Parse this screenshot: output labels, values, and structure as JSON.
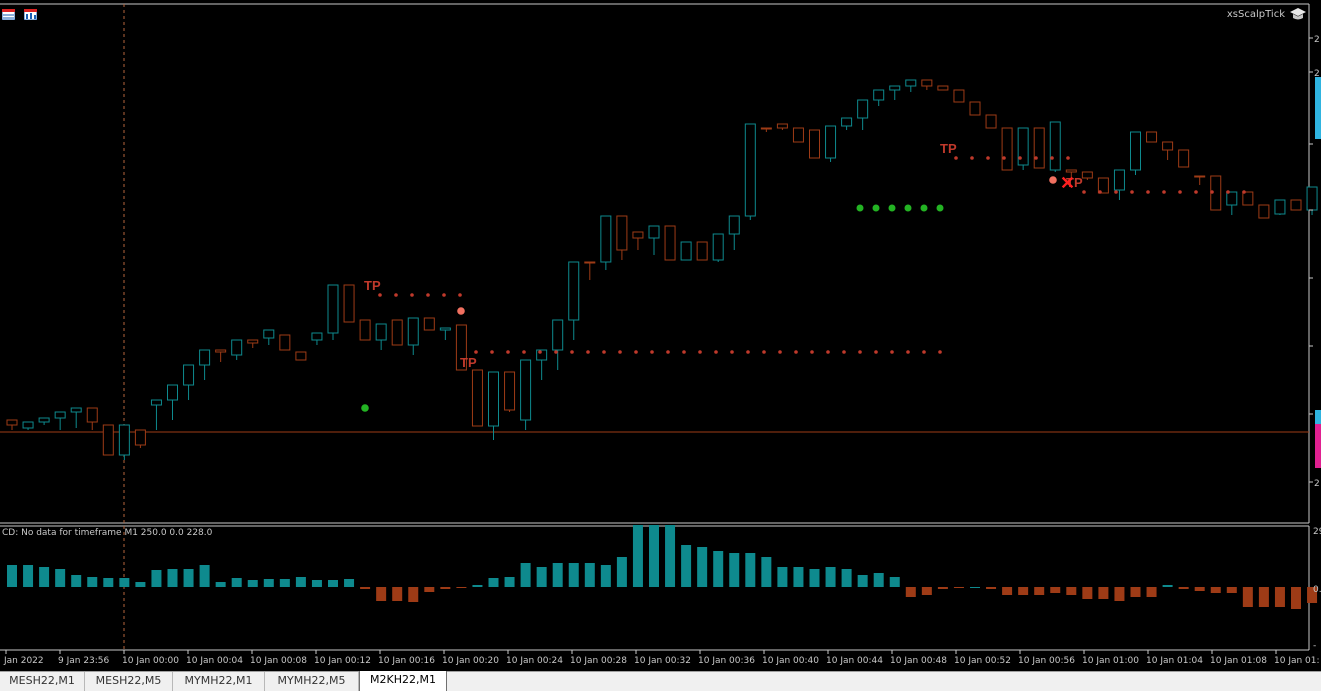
{
  "toolbar": {
    "icons": [
      "chart-grid-icon",
      "chart-props-icon"
    ]
  },
  "indicator_name": "xsScalpTick",
  "indicator_label": "CD: No data for timeframe M1 250.0 0.0 228.0",
  "price_ticks": [
    "2",
    "2",
    "2"
  ],
  "ind_ticks": [
    "29",
    "0.0",
    "-"
  ],
  "colors": {
    "bull": "#0e8a8e",
    "bear": "#9e3b16",
    "tp": "#c0392b",
    "green": "#23b323",
    "salmon": "#f07060"
  },
  "tp_label": "TP",
  "time_labels": [
    "Jan 2022",
    "9 Jan 23:56",
    "10 Jan 00:00",
    "10 Jan 00:04",
    "10 Jan 00:08",
    "10 Jan 00:12",
    "10 Jan 00:16",
    "10 Jan 00:20",
    "10 Jan 00:24",
    "10 Jan 00:28",
    "10 Jan 00:32",
    "10 Jan 00:36",
    "10 Jan 00:40",
    "10 Jan 00:44",
    "10 Jan 00:48",
    "10 Jan 00:52",
    "10 Jan 00:56",
    "10 Jan 01:00",
    "10 Jan 01:04",
    "10 Jan 01:08",
    "10 Jan 01:"
  ],
  "tabs": [
    {
      "label": "MESH22,M1",
      "active": false
    },
    {
      "label": "MESH22,M5",
      "active": false
    },
    {
      "label": "MYMH22,M1",
      "active": false
    },
    {
      "label": "MYMH22,M5",
      "active": false
    },
    {
      "label": "M2KH22,M1",
      "active": true
    }
  ],
  "chart_data": {
    "type": "candlestick",
    "candles": [
      [
        420,
        430,
        390,
        425
      ],
      [
        428,
        430,
        410,
        422
      ],
      [
        422,
        425,
        395,
        418
      ],
      [
        418,
        430,
        390,
        412
      ],
      [
        412,
        428,
        400,
        408
      ],
      [
        408,
        430,
        385,
        422
      ],
      [
        425,
        440,
        420,
        455
      ],
      [
        455,
        460,
        420,
        425
      ],
      [
        430,
        448,
        425,
        445
      ],
      [
        405,
        430,
        380,
        400
      ],
      [
        400,
        420,
        370,
        385
      ],
      [
        385,
        400,
        350,
        365
      ],
      [
        365,
        380,
        340,
        350
      ],
      [
        350,
        362,
        300,
        352
      ],
      [
        355,
        360,
        300,
        340
      ],
      [
        340,
        348,
        320,
        343
      ],
      [
        338,
        345,
        300,
        330
      ],
      [
        335,
        340,
        315,
        350
      ],
      [
        352,
        360,
        320,
        360
      ],
      [
        340,
        345,
        310,
        333
      ],
      [
        333,
        340,
        270,
        285
      ],
      [
        285,
        290,
        275,
        322
      ],
      [
        320,
        330,
        280,
        340
      ],
      [
        340,
        350,
        290,
        324
      ],
      [
        320,
        330,
        310,
        345
      ],
      [
        345,
        355,
        300,
        318
      ],
      [
        318,
        325,
        305,
        330
      ],
      [
        330,
        340,
        320,
        328
      ],
      [
        325,
        355,
        320,
        370
      ],
      [
        370,
        376,
        360,
        426
      ],
      [
        426,
        440,
        360,
        372
      ],
      [
        372,
        412,
        350,
        410
      ],
      [
        420,
        430,
        380,
        360
      ],
      [
        360,
        380,
        350,
        350
      ],
      [
        350,
        370,
        330,
        320
      ],
      [
        320,
        340,
        300,
        262
      ],
      [
        262,
        280,
        230,
        262
      ],
      [
        262,
        270,
        190,
        216
      ],
      [
        216,
        260,
        210,
        250
      ],
      [
        232,
        250,
        200,
        238
      ],
      [
        238,
        255,
        210,
        226
      ],
      [
        226,
        260,
        215,
        260
      ],
      [
        260,
        250,
        235,
        242
      ],
      [
        242,
        255,
        230,
        260
      ],
      [
        260,
        262,
        230,
        234
      ],
      [
        234,
        250,
        210,
        216
      ],
      [
        216,
        220,
        100,
        124
      ],
      [
        128,
        132,
        100,
        128
      ],
      [
        124,
        130,
        110,
        128
      ],
      [
        128,
        138,
        120,
        142
      ],
      [
        130,
        130,
        120,
        158
      ],
      [
        158,
        162,
        100,
        126
      ],
      [
        126,
        130,
        90,
        118
      ],
      [
        118,
        130,
        100,
        100
      ],
      [
        100,
        106,
        60,
        90
      ],
      [
        90,
        100,
        20,
        86
      ],
      [
        86,
        92,
        80,
        80
      ],
      [
        80,
        90,
        55,
        86
      ],
      [
        86,
        90,
        70,
        90
      ],
      [
        90,
        100,
        80,
        102
      ],
      [
        102,
        110,
        90,
        115
      ],
      [
        115,
        120,
        100,
        128
      ],
      [
        128,
        140,
        120,
        170
      ],
      [
        165,
        170,
        120,
        128
      ],
      [
        128,
        138,
        110,
        168
      ],
      [
        170,
        172,
        120,
        122
      ],
      [
        170,
        180,
        160,
        172
      ],
      [
        172,
        180,
        165,
        178
      ],
      [
        178,
        185,
        160,
        193
      ],
      [
        190,
        200,
        165,
        170
      ],
      [
        170,
        175,
        130,
        132
      ],
      [
        132,
        140,
        130,
        142
      ],
      [
        142,
        160,
        130,
        150
      ],
      [
        150,
        165,
        130,
        167
      ],
      [
        176,
        185,
        170,
        176
      ],
      [
        176,
        200,
        176,
        210
      ],
      [
        205,
        215,
        200,
        192
      ],
      [
        192,
        200,
        180,
        205
      ],
      [
        205,
        210,
        185,
        218
      ],
      [
        214,
        215,
        195,
        200
      ],
      [
        200,
        210,
        190,
        210
      ],
      [
        210,
        215,
        180,
        187
      ],
      [
        187,
        200,
        180,
        204
      ],
      [
        204,
        215,
        195,
        220
      ],
      [
        200,
        210,
        190,
        205
      ],
      [
        205,
        215,
        180,
        225
      ],
      [
        225,
        230,
        180,
        245
      ],
      [
        245,
        250,
        245,
        288
      ],
      [
        288,
        340,
        240,
        280
      ],
      [
        280,
        300,
        240,
        335
      ],
      [
        335,
        340,
        260,
        264
      ],
      [
        264,
        275,
        250,
        295
      ],
      [
        295,
        300,
        250,
        324
      ],
      [
        324,
        330,
        250,
        255
      ],
      [
        255,
        260,
        240,
        248
      ],
      [
        250,
        260,
        230,
        244
      ],
      [
        244,
        260,
        220,
        238
      ],
      [
        240,
        270,
        230,
        244
      ],
      [
        244,
        260,
        230,
        235
      ],
      [
        235,
        240,
        180,
        206
      ],
      [
        206,
        215,
        180,
        210
      ],
      [
        210,
        220,
        180,
        204
      ],
      [
        204,
        210,
        180,
        196
      ]
    ],
    "histogram": [
      22,
      22,
      20,
      18,
      12,
      10,
      9,
      9,
      5,
      17,
      18,
      18,
      22,
      5,
      9,
      7,
      8,
      8,
      10,
      7,
      7,
      8,
      -2,
      -14,
      -14,
      -15,
      -5,
      -2,
      -1,
      2,
      9,
      10,
      24,
      20,
      24,
      24,
      24,
      22,
      30,
      62,
      62,
      62,
      42,
      40,
      36,
      34,
      34,
      30,
      20,
      20,
      18,
      20,
      18,
      12,
      14,
      10,
      -10,
      -8,
      -2,
      -1,
      0,
      -2,
      -8,
      -8,
      -8,
      -6,
      -8,
      -12,
      -12,
      -14,
      -10,
      -10,
      2,
      -2,
      -4,
      -6,
      -6,
      -20,
      -20,
      -20,
      -22,
      -16,
      -12,
      -10,
      -12,
      -12,
      -10,
      -6,
      -6,
      -4,
      -4,
      -4
    ]
  }
}
